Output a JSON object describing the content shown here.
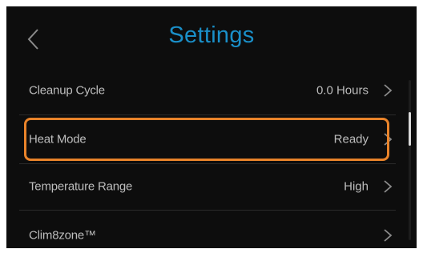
{
  "header": {
    "title": "Settings",
    "back_icon": "chevron-left-icon"
  },
  "settings": {
    "items": [
      {
        "label": "Cleanup Cycle",
        "value": "0.0 Hours"
      },
      {
        "label": "Heat Mode",
        "value": "Ready",
        "highlighted": true
      },
      {
        "label": "Temperature Range",
        "value": "High"
      },
      {
        "label": "Clim8zone™",
        "value": ""
      }
    ]
  },
  "colors": {
    "background": "#0d0d0d",
    "title": "#1a8fc8",
    "text": "#bdbdbd",
    "highlight": "#e8832a"
  }
}
